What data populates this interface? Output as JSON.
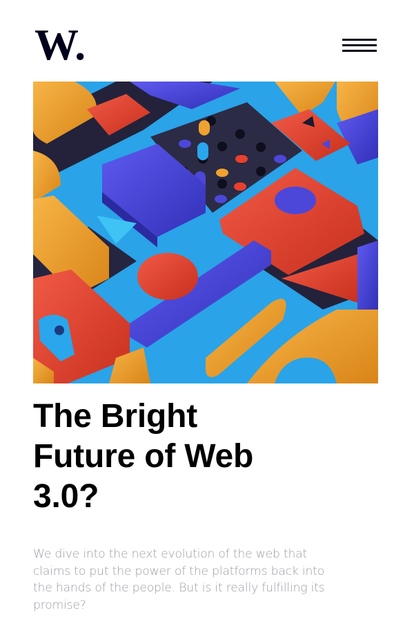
{
  "header": {
    "logo_text": "W.",
    "logo_icon": "brand-w-logo",
    "menu_icon": "hamburger-menu-icon"
  },
  "hero": {
    "image": "abstract-3d-colorful-geometric-blocks",
    "colors": [
      "#f0a22e",
      "#e8402f",
      "#4c47d8",
      "#2aa6ec",
      "#2b2a40"
    ]
  },
  "article": {
    "title": "The Bright Future of Web 3.0?",
    "description": "We dive into the next evolution of the web that claims to put the power of the platforms back into the hands of the people. But is it really fulfilling its promise?"
  },
  "colors": {
    "text_dark": "#00001a",
    "text_muted": "#9b9ba6",
    "background": "#ffffff"
  }
}
